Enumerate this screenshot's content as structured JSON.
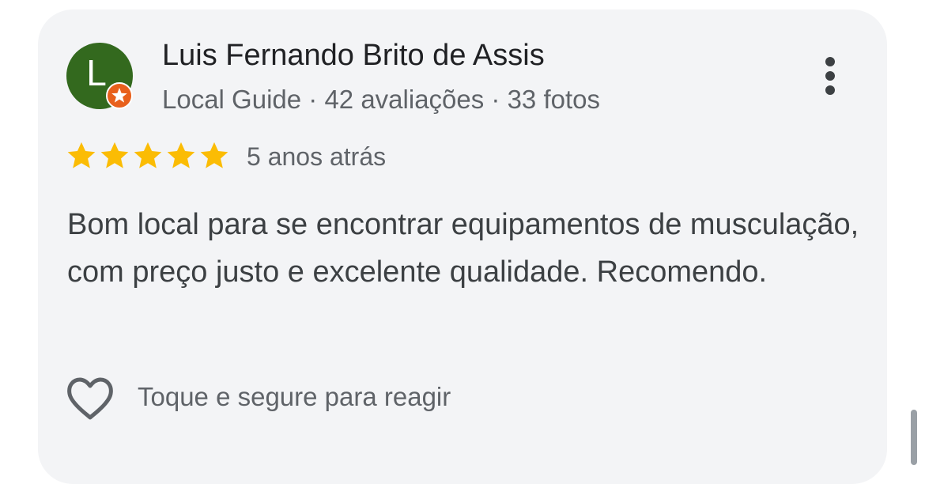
{
  "review": {
    "author": {
      "initial": "L",
      "name": "Luis Fernando Brito de Assis",
      "meta": "Local Guide · 42 avaliações · 33 fotos",
      "avatar_color": "#33691e",
      "badge_color": "#e8601c"
    },
    "rating": 5,
    "rating_max": 5,
    "star_color": "#fbbc04",
    "time": "5 anos atrás",
    "text": "Bom local para se encontrar equipamentos de musculação, com preço justo e excelente qualidade. Recomendo.",
    "react_hint": "Toque e segure para reagir",
    "icons": {
      "more": "more-vert-icon",
      "react": "heart-outline-icon",
      "badge": "local-guide-star-icon"
    }
  }
}
